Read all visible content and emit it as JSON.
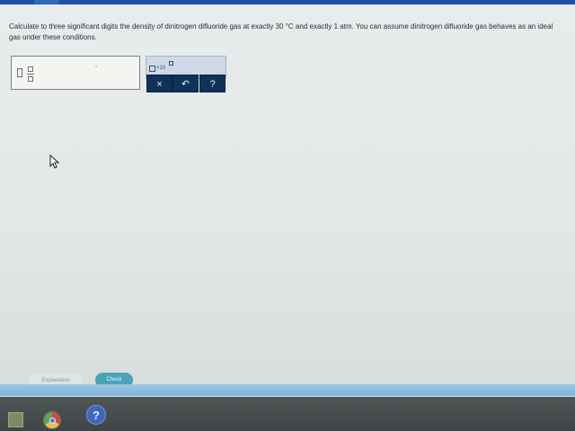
{
  "question": {
    "text": "Calculate to three significant digits the density of dinitrogen difluoride gas at exactly 30 °C and exactly 1 atm. You can assume dinitrogen difluoride gas behaves as an ideal gas under these conditions."
  },
  "answer": {
    "value": ""
  },
  "toolbar": {
    "scientific_notation_label": "×10",
    "clear_label": "×",
    "undo_label": "↶",
    "help_label": "?"
  },
  "footer": {
    "explanation_label": "Explanation",
    "check_label": "Check"
  },
  "taskbar": {
    "help_label": "?"
  },
  "colors": {
    "accent": "#1f4fa3",
    "button_dark": "#103159",
    "check_button": "#4aa3b8"
  },
  "icons": {
    "toggle": "chevron-down-icon",
    "clear": "close-icon",
    "undo": "undo-icon",
    "help": "help-icon",
    "cursor": "mouse-cursor-icon",
    "explorer": "file-explorer-icon",
    "chrome": "chrome-icon"
  }
}
